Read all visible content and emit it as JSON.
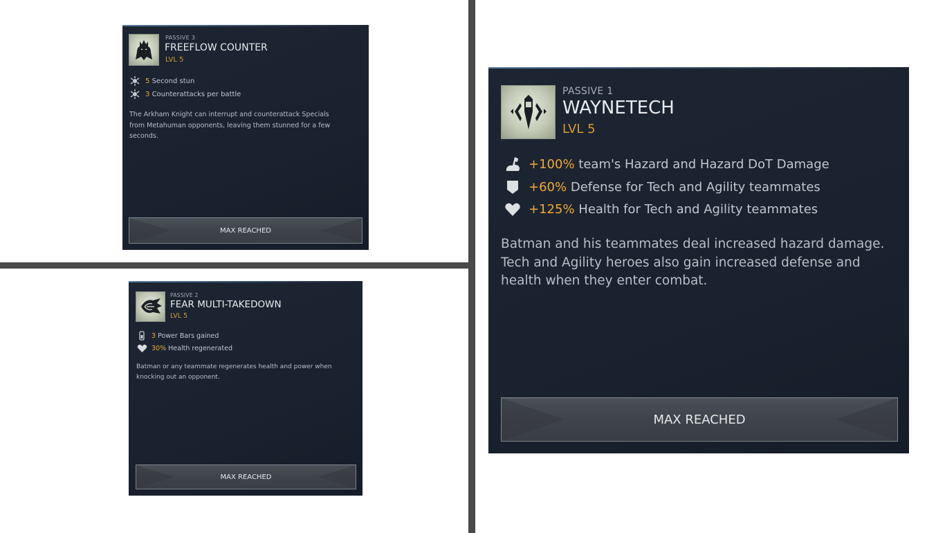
{
  "cards": [
    {
      "kicker": "PASSIVE 3",
      "title": "FREEFLOW COUNTER",
      "level": "LVL 5",
      "icon": "arkham-knight-icon",
      "stats": [
        {
          "icon": "stun-icon",
          "value": "5",
          "text": "Second stun"
        },
        {
          "icon": "stun-icon",
          "value": "3",
          "text": "Counterattacks per battle"
        }
      ],
      "description": "The Arkham Knight can interrupt and counterattack Specials from Metahuman opponents, leaving them stunned for a few seconds.",
      "button": "MAX REACHED"
    },
    {
      "kicker": "PASSIVE 2",
      "title": "FEAR MULTI-TAKEDOWN",
      "level": "LVL 5",
      "icon": "fear-takedown-icon",
      "stats": [
        {
          "icon": "power-bar-icon",
          "value": "3",
          "text": "Power Bars gained"
        },
        {
          "icon": "heart-icon",
          "value": "30%",
          "text": "Health regenerated"
        }
      ],
      "description": "Batman or any teammate regenerates health and power when knocking out an opponent.",
      "button": "MAX REACHED"
    },
    {
      "kicker": "PASSIVE 1",
      "title": "WAYNETECH",
      "level": "LVL 5",
      "icon": "waynetech-icon",
      "stats": [
        {
          "icon": "hazard-arm-icon",
          "value": "+100%",
          "text": "team's Hazard and Hazard DoT Damage"
        },
        {
          "icon": "shield-icon",
          "value": "+60%",
          "text": "Defense for Tech and Agility teammates"
        },
        {
          "icon": "heart-icon",
          "value": "+125%",
          "text": "Health for Tech and Agility teammates"
        }
      ],
      "description": "Batman and his teammates deal increased hazard damage. Tech and Agility heroes also gain increased defense and health when they enter combat.",
      "button": "MAX REACHED"
    }
  ],
  "colors": {
    "card_bg": "#1c2432",
    "accent_gold": "#f0aa33",
    "level_gold": "#d39b2e",
    "divider": "#4a4a4a"
  }
}
